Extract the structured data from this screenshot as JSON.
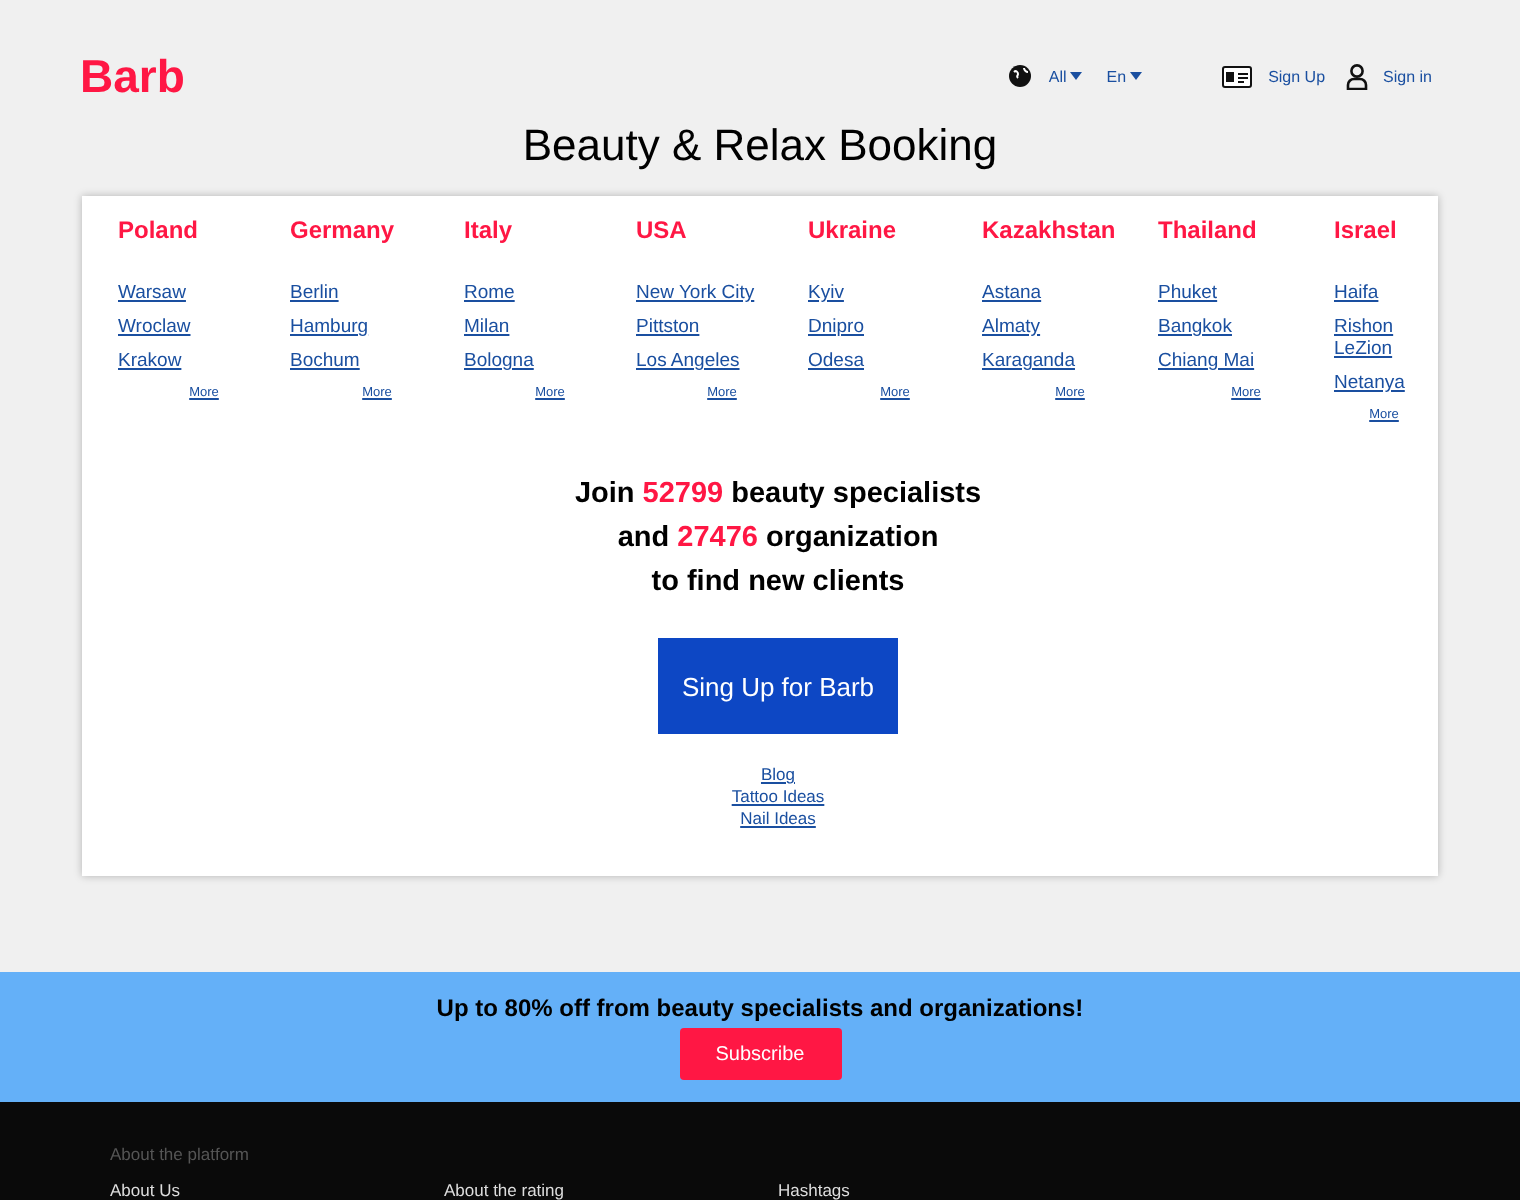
{
  "header": {
    "logo": "Barb",
    "region": "All",
    "language": "En",
    "sign_up": "Sign Up",
    "sign_in": "Sign in"
  },
  "title": "Beauty & Relax Booking",
  "countries": [
    {
      "name": "Poland",
      "cities": [
        "Warsaw",
        "Wroclaw",
        "Krakow"
      ],
      "more": "More"
    },
    {
      "name": "Germany",
      "cities": [
        "Berlin",
        "Hamburg",
        "Bochum"
      ],
      "more": "More"
    },
    {
      "name": "Italy",
      "cities": [
        "Rome",
        "Milan",
        "Bologna"
      ],
      "more": "More"
    },
    {
      "name": "USA",
      "cities": [
        "New York City",
        "Pittston",
        "Los Angeles"
      ],
      "more": "More"
    },
    {
      "name": "Ukraine",
      "cities": [
        "Kyiv",
        "Dnipro",
        "Odesa"
      ],
      "more": "More"
    },
    {
      "name": "Kazakhstan",
      "cities": [
        "Astana",
        "Almaty",
        "Karaganda"
      ],
      "more": "More"
    },
    {
      "name": "Thailand",
      "cities": [
        "Phuket",
        "Bangkok",
        "Chiang Mai"
      ],
      "more": "More"
    },
    {
      "name": "Israel",
      "cities": [
        "Haifa",
        "Rishon LeZion",
        "Netanya"
      ],
      "more": "More"
    }
  ],
  "join": [
    {
      "before": "Join ",
      "number": "52799",
      "after": " beauty specialists"
    },
    {
      "before": "and ",
      "number": "27476",
      "after": " organization"
    },
    {
      "before": "to find new clients"
    }
  ],
  "cta": "Sing Up for Barb",
  "links": [
    "Blog",
    "Tattoo Ideas",
    "Nail Ideas"
  ],
  "promo": {
    "text": "Up to 80% off from beauty specialists and organizations!",
    "button": "Subscribe"
  },
  "footer": {
    "heading": "About the platform",
    "links": [
      "About Us",
      "About the rating",
      "Hashtags"
    ]
  }
}
